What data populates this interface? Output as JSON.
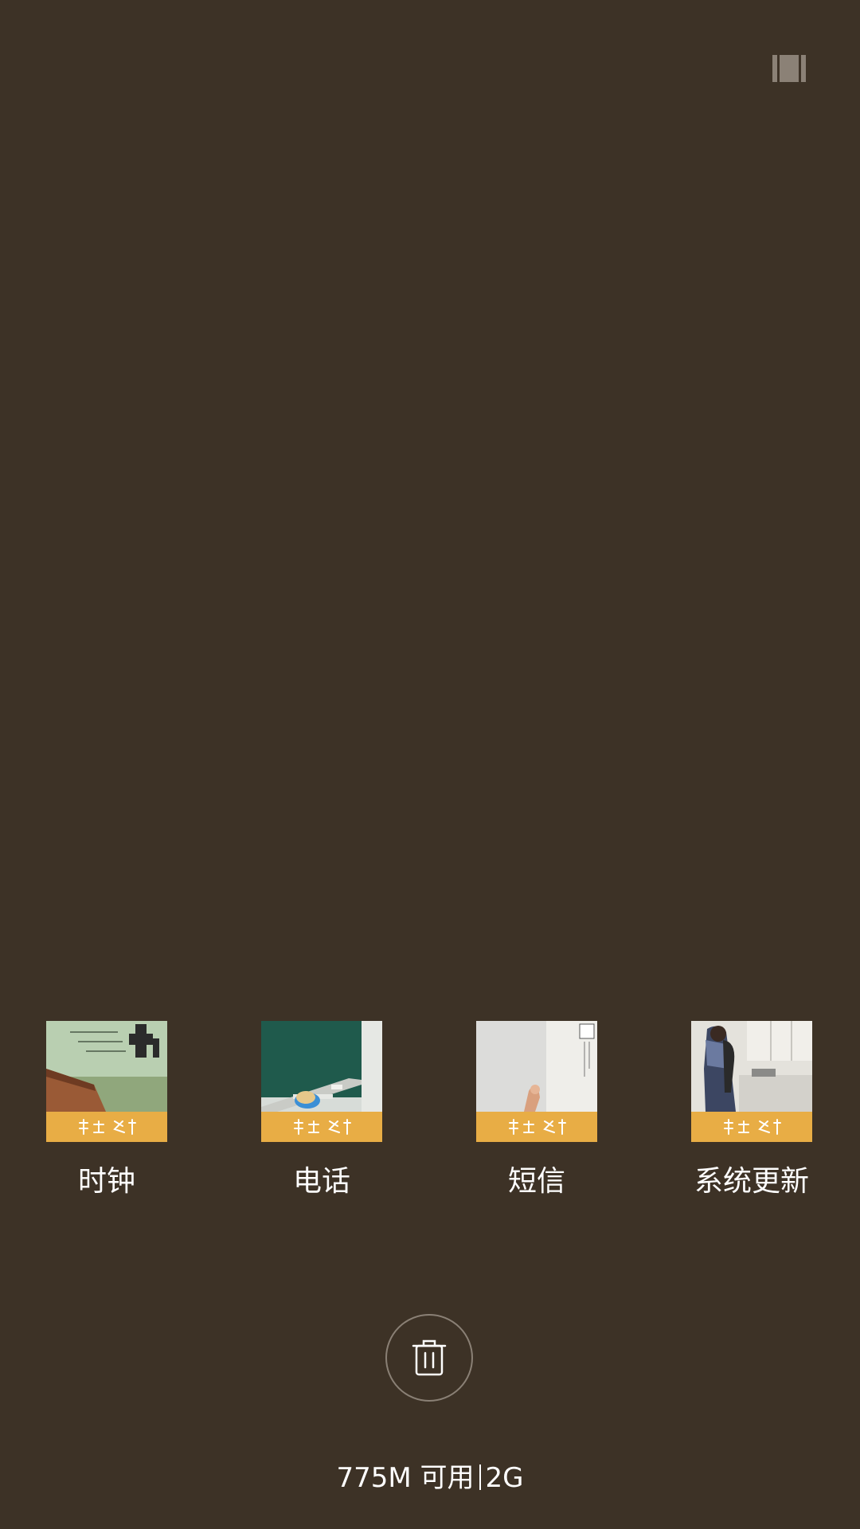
{
  "recents": {
    "view_toggle_icon": "multi-window-icon",
    "apps": [
      {
        "label": "时钟",
        "thumbnail_icon": "clock-app-thumbnail"
      },
      {
        "label": "电话",
        "thumbnail_icon": "phone-app-thumbnail"
      },
      {
        "label": "短信",
        "thumbnail_icon": "messages-app-thumbnail"
      },
      {
        "label": "系统更新",
        "thumbnail_icon": "system-update-app-thumbnail"
      }
    ],
    "clear_icon": "trash-icon",
    "memory": {
      "available": "775M 可用",
      "total": "2G"
    }
  },
  "colors": {
    "background": "#3d3226",
    "thumbnail_band": "#e8ad45",
    "text": "#ffffff"
  }
}
